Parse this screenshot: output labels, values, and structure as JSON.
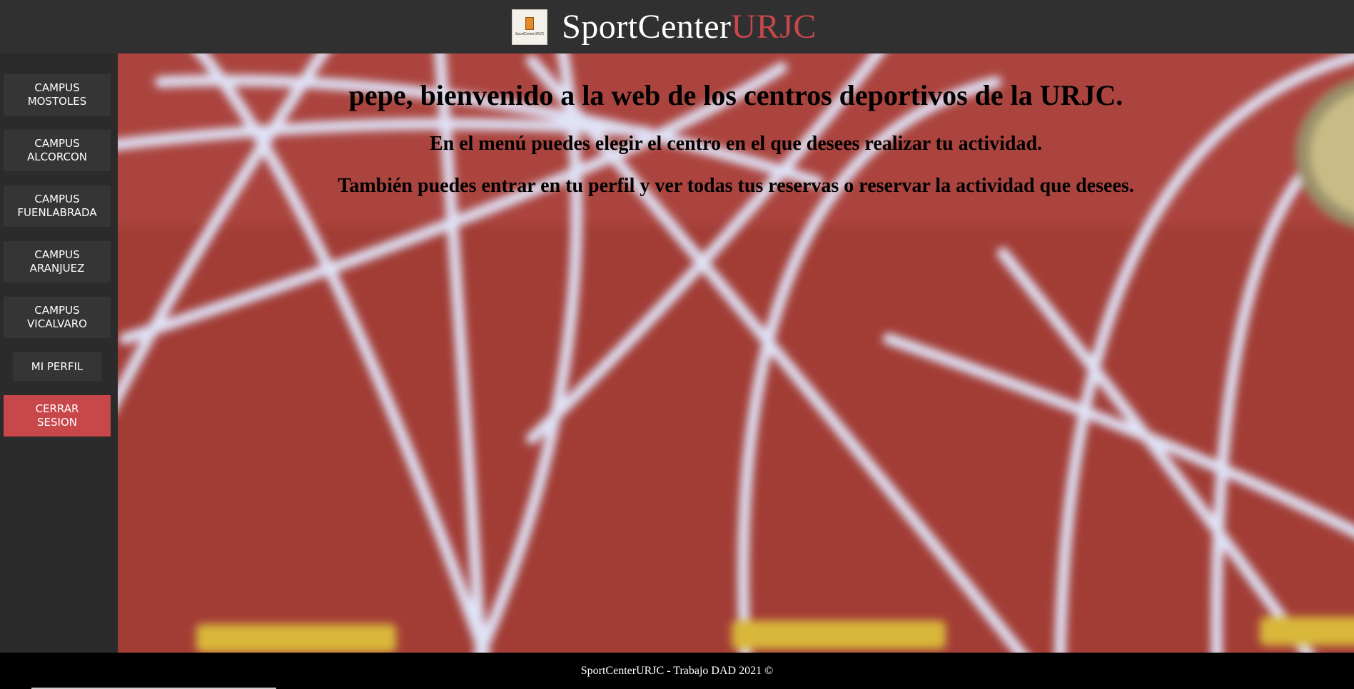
{
  "header": {
    "brand_primary": "SportCenter",
    "brand_accent": "URJC",
    "logo_text": "SportCenterURJC"
  },
  "sidebar": {
    "items": [
      {
        "label": "CAMPUS\nMOSTOLES"
      },
      {
        "label": "CAMPUS\nALCORCON"
      },
      {
        "label": "CAMPUS\nFUENLABRADA"
      },
      {
        "label": "CAMPUS\nARANJUEZ"
      },
      {
        "label": "CAMPUS\nVICALVARO"
      },
      {
        "label": "MI PERFIL"
      },
      {
        "label": "CERRAR\nSESION"
      }
    ]
  },
  "main": {
    "heading": "pepe, bienvenido a la web de los centros deportivos de la URJC.",
    "line1": "En el menú puedes elegir el centro en el que desees realizar tu actividad.",
    "line2": "También puedes entrar en tu perfil y ver todas tus reservas o reservar la actividad que desees."
  },
  "footer": {
    "text": "SportCenterURJC - Trabajo DAD 2021 ©"
  },
  "colors": {
    "accent": "#c8474b",
    "header_bg": "#303030",
    "sidebar_bg": "#2b2b2b",
    "button_bg": "#353535",
    "footer_bg": "#000000",
    "track_red": "#a03b34"
  }
}
